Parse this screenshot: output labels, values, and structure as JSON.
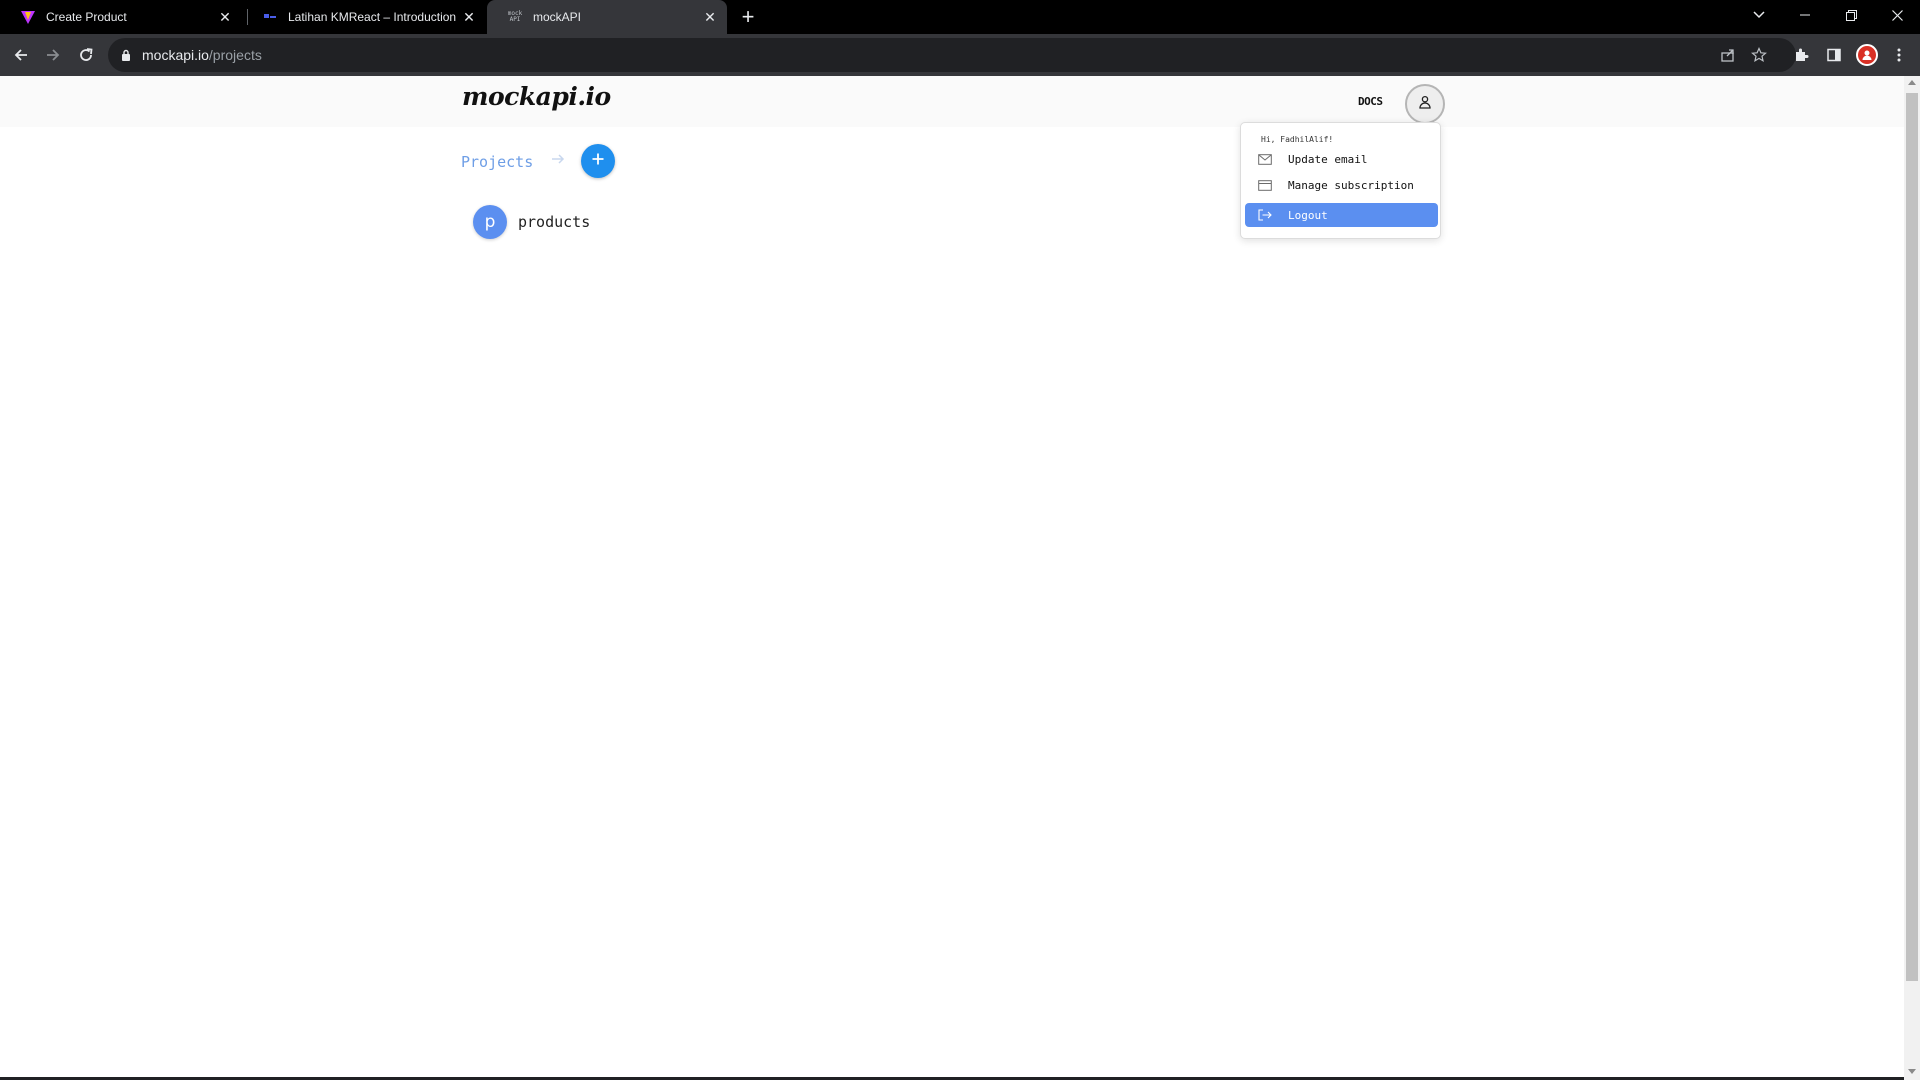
{
  "browser": {
    "tabs": [
      {
        "title": "Create Product",
        "favicon": "vite-icon",
        "active": false
      },
      {
        "title": "Latihan KMReact – Introduction",
        "favicon": "page-icon",
        "active": false
      },
      {
        "title": "mockAPI",
        "favicon": "mockapi-icon",
        "favicon_text": "mock API",
        "active": true
      }
    ],
    "url_host": "mockapi.io",
    "url_path": "/projects"
  },
  "header": {
    "logo": "mockapi.io",
    "docs_label": "DOCS"
  },
  "breadcrumb": {
    "projects_label": "Projects",
    "add_label": "+"
  },
  "projects": [
    {
      "initial": "p",
      "name": "products"
    }
  ],
  "user_menu": {
    "greeting": "Hi, FadhilAlif!",
    "items": [
      {
        "label": "Update email",
        "icon": "mail-icon",
        "active": false
      },
      {
        "label": "Manage subscription",
        "icon": "credit-card-icon",
        "active": false
      },
      {
        "label": "Logout",
        "icon": "logout-icon",
        "active": true
      }
    ]
  },
  "colors": {
    "accent": "#1f8fee",
    "menu_active": "#5b8ff0",
    "link": "#6e9ee6"
  }
}
